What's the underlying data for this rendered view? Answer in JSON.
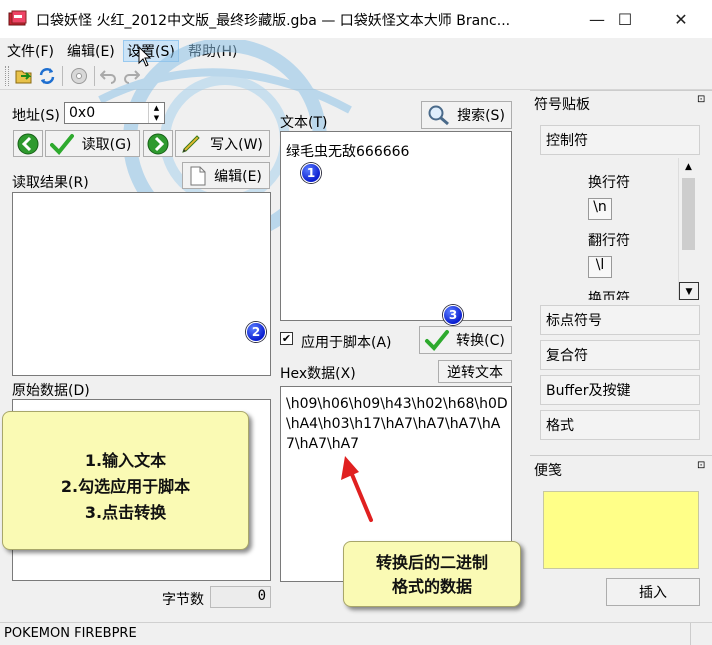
{
  "window": {
    "title": "口袋妖怪 火红_2012中文版_最终珍藏版.gba — 口袋妖怪文本大师 Branc...",
    "minimize": "—",
    "maximize": "☐",
    "close": "✕"
  },
  "menu": [
    "文件(F)",
    "编辑(E)",
    "设置(S)",
    "帮助(H)"
  ],
  "left": {
    "address_label": "地址(S)",
    "address_value": "0x0",
    "read_button": "读取(G)",
    "write_button": "写入(W)",
    "edit_button": "编辑(E)",
    "read_result_label": "读取结果(R)",
    "raw_data_label": "原始数据(D)",
    "byte_count_label": "字节数",
    "byte_count_value": "0"
  },
  "center": {
    "text_label": "文本(T)",
    "search_button": "搜索(S)",
    "text_content": "绿毛虫无敌666666",
    "apply_script_label": "应用于脚本(A)",
    "apply_script_checked": true,
    "convert_button": "转换(C)",
    "hex_label": "Hex数据(X)",
    "reverse_button": "逆转文本",
    "hex_content": "\\h09\\h06\\h09\\h43\\h02\\h68\\h0D\\hA4\\h03\\h17\\hA7\\hA7\\hA7\\hA7\\hA7\\hA7"
  },
  "symbol_panel": {
    "title": "符号贴板",
    "pin": "⊡",
    "control_header": "控制符",
    "items": [
      {
        "label": "换行符",
        "code": "\\n"
      },
      {
        "label": "翻行符",
        "code": "\\l"
      }
    ],
    "partial_label": "换页符",
    "sections": [
      "标点符号",
      "复合符",
      "Buffer及按键",
      "格式"
    ]
  },
  "memo_panel": {
    "title": "便笺",
    "pin": "⊡",
    "insert_button": "插入",
    "note_color": "#ffff88"
  },
  "statusbar": {
    "text": "POKEMON FIREBPRE"
  },
  "annotations": {
    "markers": [
      "1",
      "2",
      "3"
    ],
    "steps_note": [
      "1.输入文本",
      "2.勾选应用于脚本",
      "3.点击转换"
    ],
    "result_note": [
      "转换后的二进制",
      "格式的数据"
    ],
    "note_color": "#fafab4"
  }
}
